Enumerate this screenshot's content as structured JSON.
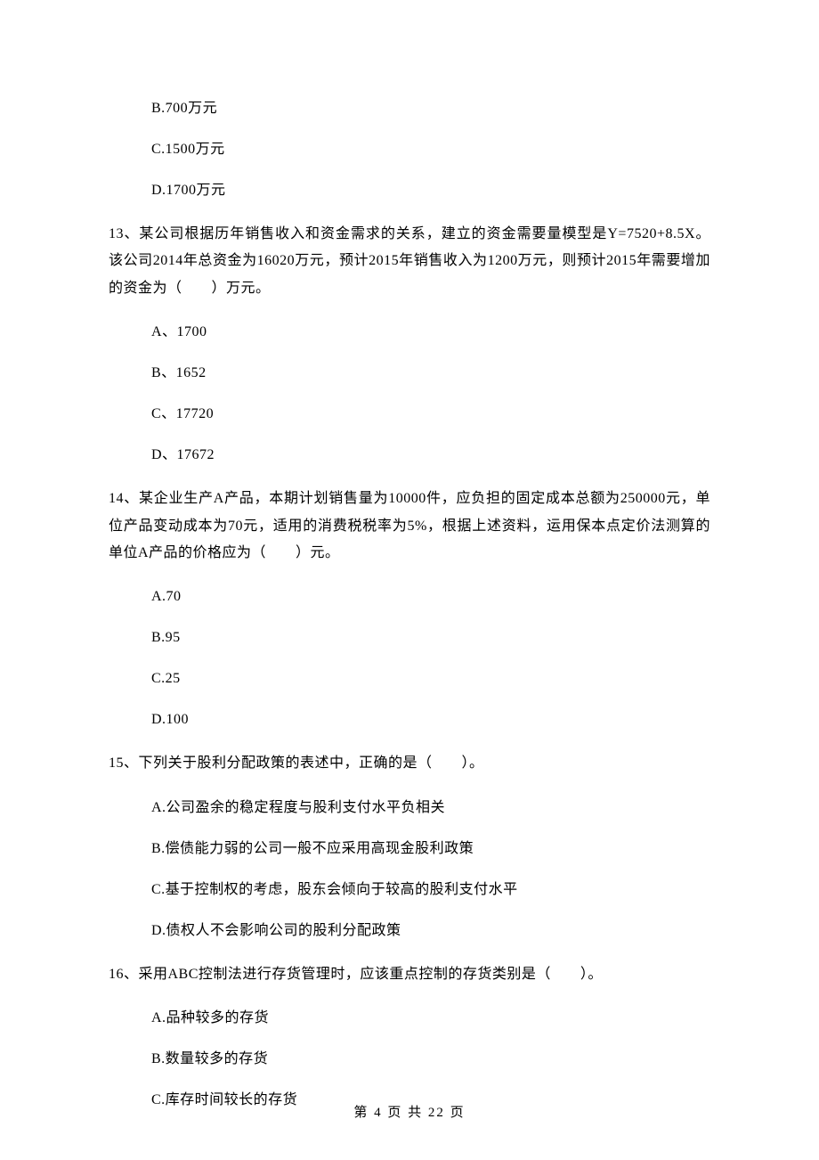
{
  "prev_options": {
    "b": "B.700万元",
    "c": "C.1500万元",
    "d": "D.1700万元"
  },
  "q13": {
    "stem": "13、某公司根据历年销售收入和资金需求的关系，建立的资金需要量模型是Y=7520+8.5X。该公司2014年总资金为16020万元，预计2015年销售收入为1200万元，则预计2015年需要增加的资金为（　　）万元。",
    "a": "A、1700",
    "b": "B、1652",
    "c": "C、17720",
    "d": "D、17672"
  },
  "q14": {
    "stem": "14、某企业生产A产品，本期计划销售量为10000件，应负担的固定成本总额为250000元，单位产品变动成本为70元，适用的消费税税率为5%，根据上述资料，运用保本点定价法测算的单位A产品的价格应为（　　）元。",
    "a": "A.70",
    "b": "B.95",
    "c": "C.25",
    "d": "D.100"
  },
  "q15": {
    "stem": "15、下列关于股利分配政策的表述中，正确的是（　　）。",
    "a": "A.公司盈余的稳定程度与股利支付水平负相关",
    "b": "B.偿债能力弱的公司一般不应采用高现金股利政策",
    "c": "C.基于控制权的考虑，股东会倾向于较高的股利支付水平",
    "d": "D.债权人不会影响公司的股利分配政策"
  },
  "q16": {
    "stem": "16、采用ABC控制法进行存货管理时，应该重点控制的存货类别是（　　）。",
    "a": "A.品种较多的存货",
    "b": "B.数量较多的存货",
    "c": "C.库存时间较长的存货"
  },
  "footer": "第 4 页 共 22 页"
}
